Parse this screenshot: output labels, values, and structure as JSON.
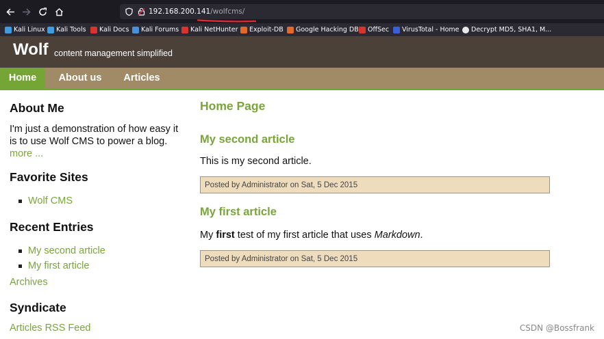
{
  "browser": {
    "url_host": "192.168.200.141",
    "url_path": "/wolfcms/",
    "bookmarks": [
      {
        "label": "Kali Linux",
        "icon": "kali-dragon-icon",
        "color": "#3c9de0"
      },
      {
        "label": "Kali Tools",
        "icon": "kali-dragon-icon",
        "color": "#3c9de0"
      },
      {
        "label": "Kali Docs",
        "icon": "kali-docs-icon",
        "color": "#d8332e"
      },
      {
        "label": "Kali Forums",
        "icon": "kali-forums-icon",
        "color": "#4a8fd8"
      },
      {
        "label": "Kali NetHunter",
        "icon": "nethunter-icon",
        "color": "#d8332e"
      },
      {
        "label": "Exploit-DB",
        "icon": "exploit-db-icon",
        "color": "#e06a2a"
      },
      {
        "label": "Google Hacking DB",
        "icon": "ghdb-icon",
        "color": "#e06a2a"
      },
      {
        "label": "OffSec",
        "icon": "offsec-icon",
        "color": "#d8332e"
      },
      {
        "label": "VirusTotal - Home",
        "icon": "virustotal-icon",
        "color": "#3a5fd8"
      },
      {
        "label": "Decrypt MD5, SHA1, M...",
        "icon": "decrypt-icon",
        "color": "#e8e8e8"
      }
    ]
  },
  "site": {
    "logo": "Wolf",
    "slogan": "content management simplified",
    "nav": [
      "Home",
      "About us",
      "Articles"
    ]
  },
  "sidebar": {
    "about_heading": "About Me",
    "about_text": "I'm just a demonstration of how easy it is to use Wolf CMS to power a blog.",
    "about_more": "more ...",
    "favorites_heading": "Favorite Sites",
    "favorites": [
      "Wolf CMS"
    ],
    "recent_heading": "Recent Entries",
    "recent": [
      "My second article",
      "My first article"
    ],
    "archives": "Archives",
    "syndicate_heading": "Syndicate",
    "rss": "Articles RSS Feed"
  },
  "content": {
    "page_title": "Home Page",
    "articles": [
      {
        "title": "My second article",
        "body": "This is my second article.",
        "info": "Posted by Administrator on Sat, 5 Dec 2015"
      },
      {
        "title": "My first article",
        "body_prefix": "My ",
        "body_bold": "first",
        "body_middle": " test of my first article that uses ",
        "body_italic": "Markdown",
        "body_suffix": ".",
        "info": "Posted by Administrator on Sat, 5 Dec 2015"
      }
    ]
  },
  "watermark": "CSDN @Bossfrank",
  "colors": {
    "header_bg": "#4c4139",
    "nav_bg": "#a08b66",
    "accent_green": "#74a535",
    "link_green": "#7aa43c",
    "info_bg": "#eedcbd",
    "annotation_red": "#e52b2b"
  }
}
